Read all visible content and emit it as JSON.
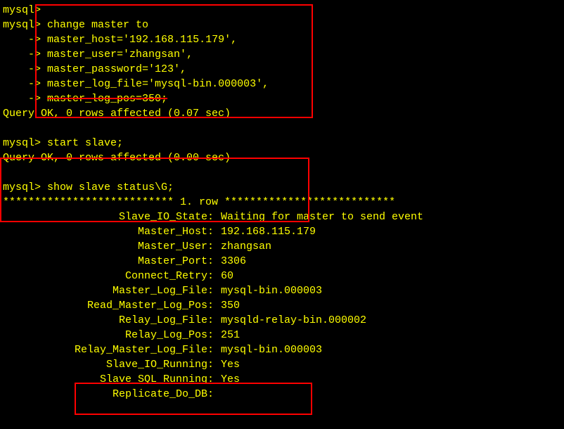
{
  "prompts": {
    "mysql": "mysql>",
    "arrow": "    ->"
  },
  "commands": {
    "change_master": "change master to",
    "master_host": "master_host='192.168.115.179',",
    "master_user": "master_user='zhangsan',",
    "master_password": "master_password='123',",
    "master_log_file": "master_log_file='mysql-bin.000003',",
    "master_log_pos": "master_log_pos=350;",
    "start_slave": "start slave;",
    "show_slave_status": "show slave status\\G;"
  },
  "results": {
    "query_ok_1": "Query OK, 0 rows affected (0.07 sec)",
    "query_ok_2": "Query OK, 0 rows affected (0.00 sec)",
    "row_header": "*************************** 1. row ***************************"
  },
  "status": {
    "slave_io_state": {
      "key": "Slave_IO_State:",
      "val": "Waiting for master to send event"
    },
    "master_host": {
      "key": "Master_Host:",
      "val": "192.168.115.179"
    },
    "master_user": {
      "key": "Master_User:",
      "val": "zhangsan"
    },
    "master_port": {
      "key": "Master_Port:",
      "val": "3306"
    },
    "connect_retry": {
      "key": "Connect_Retry:",
      "val": "60"
    },
    "master_log_file": {
      "key": "Master_Log_File:",
      "val": "mysql-bin.000003"
    },
    "read_master_log_pos": {
      "key": "Read_Master_Log_Pos:",
      "val": "350"
    },
    "relay_log_file": {
      "key": "Relay_Log_File:",
      "val": "mysqld-relay-bin.000002"
    },
    "relay_log_pos": {
      "key": "Relay_Log_Pos:",
      "val": "251"
    },
    "relay_master_log_file": {
      "key": "Relay_Master_Log_File:",
      "val": "mysql-bin.000003"
    },
    "slave_io_running": {
      "key": "Slave_IO_Running:",
      "val": "Yes"
    },
    "slave_sql_running": {
      "key": "Slave_SQL_Running:",
      "val": "Yes"
    },
    "replicate_do_db": {
      "key": "Replicate_Do_DB:",
      "val": ""
    }
  }
}
